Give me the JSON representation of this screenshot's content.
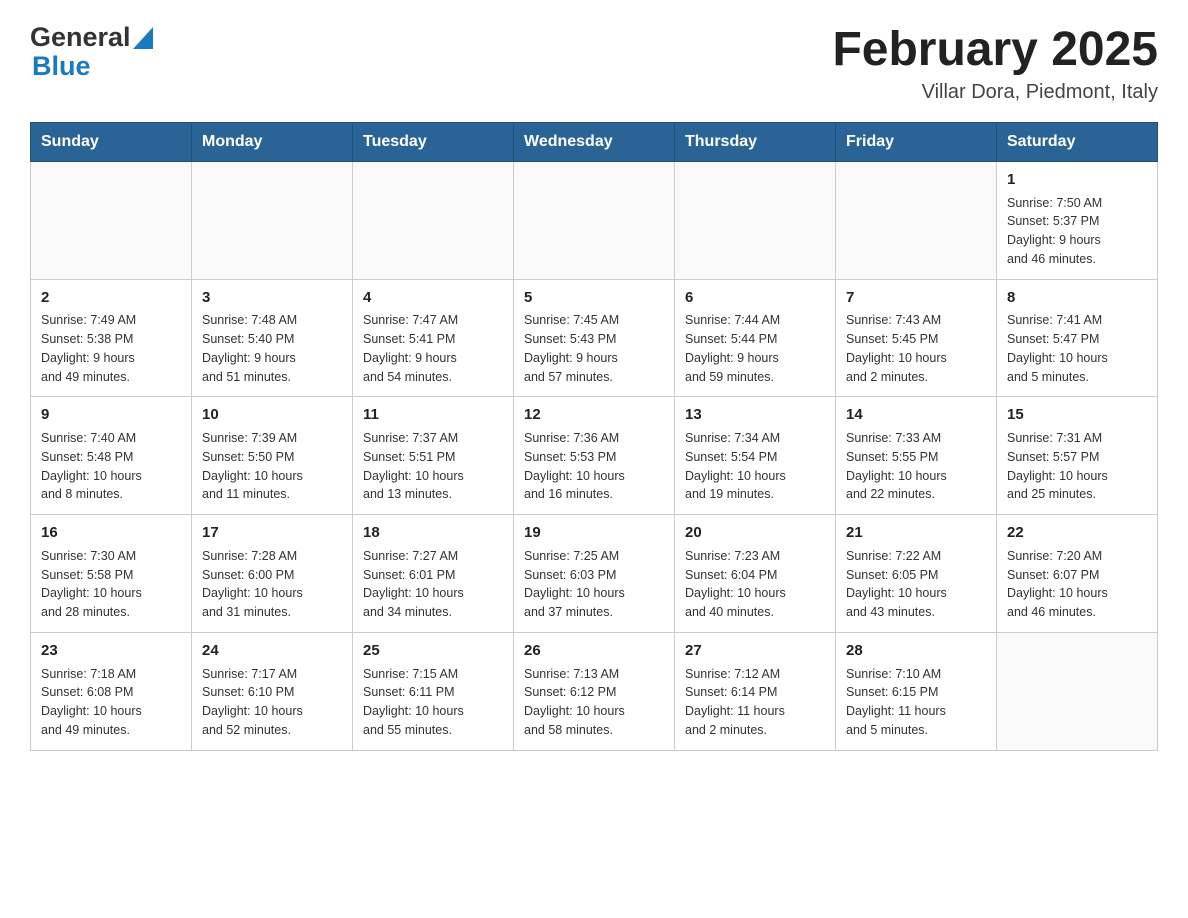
{
  "header": {
    "logo_general": "General",
    "logo_blue": "Blue",
    "title": "February 2025",
    "subtitle": "Villar Dora, Piedmont, Italy"
  },
  "weekdays": [
    "Sunday",
    "Monday",
    "Tuesday",
    "Wednesday",
    "Thursday",
    "Friday",
    "Saturday"
  ],
  "weeks": [
    [
      {
        "day": "",
        "info": ""
      },
      {
        "day": "",
        "info": ""
      },
      {
        "day": "",
        "info": ""
      },
      {
        "day": "",
        "info": ""
      },
      {
        "day": "",
        "info": ""
      },
      {
        "day": "",
        "info": ""
      },
      {
        "day": "1",
        "info": "Sunrise: 7:50 AM\nSunset: 5:37 PM\nDaylight: 9 hours\nand 46 minutes."
      }
    ],
    [
      {
        "day": "2",
        "info": "Sunrise: 7:49 AM\nSunset: 5:38 PM\nDaylight: 9 hours\nand 49 minutes."
      },
      {
        "day": "3",
        "info": "Sunrise: 7:48 AM\nSunset: 5:40 PM\nDaylight: 9 hours\nand 51 minutes."
      },
      {
        "day": "4",
        "info": "Sunrise: 7:47 AM\nSunset: 5:41 PM\nDaylight: 9 hours\nand 54 minutes."
      },
      {
        "day": "5",
        "info": "Sunrise: 7:45 AM\nSunset: 5:43 PM\nDaylight: 9 hours\nand 57 minutes."
      },
      {
        "day": "6",
        "info": "Sunrise: 7:44 AM\nSunset: 5:44 PM\nDaylight: 9 hours\nand 59 minutes."
      },
      {
        "day": "7",
        "info": "Sunrise: 7:43 AM\nSunset: 5:45 PM\nDaylight: 10 hours\nand 2 minutes."
      },
      {
        "day": "8",
        "info": "Sunrise: 7:41 AM\nSunset: 5:47 PM\nDaylight: 10 hours\nand 5 minutes."
      }
    ],
    [
      {
        "day": "9",
        "info": "Sunrise: 7:40 AM\nSunset: 5:48 PM\nDaylight: 10 hours\nand 8 minutes."
      },
      {
        "day": "10",
        "info": "Sunrise: 7:39 AM\nSunset: 5:50 PM\nDaylight: 10 hours\nand 11 minutes."
      },
      {
        "day": "11",
        "info": "Sunrise: 7:37 AM\nSunset: 5:51 PM\nDaylight: 10 hours\nand 13 minutes."
      },
      {
        "day": "12",
        "info": "Sunrise: 7:36 AM\nSunset: 5:53 PM\nDaylight: 10 hours\nand 16 minutes."
      },
      {
        "day": "13",
        "info": "Sunrise: 7:34 AM\nSunset: 5:54 PM\nDaylight: 10 hours\nand 19 minutes."
      },
      {
        "day": "14",
        "info": "Sunrise: 7:33 AM\nSunset: 5:55 PM\nDaylight: 10 hours\nand 22 minutes."
      },
      {
        "day": "15",
        "info": "Sunrise: 7:31 AM\nSunset: 5:57 PM\nDaylight: 10 hours\nand 25 minutes."
      }
    ],
    [
      {
        "day": "16",
        "info": "Sunrise: 7:30 AM\nSunset: 5:58 PM\nDaylight: 10 hours\nand 28 minutes."
      },
      {
        "day": "17",
        "info": "Sunrise: 7:28 AM\nSunset: 6:00 PM\nDaylight: 10 hours\nand 31 minutes."
      },
      {
        "day": "18",
        "info": "Sunrise: 7:27 AM\nSunset: 6:01 PM\nDaylight: 10 hours\nand 34 minutes."
      },
      {
        "day": "19",
        "info": "Sunrise: 7:25 AM\nSunset: 6:03 PM\nDaylight: 10 hours\nand 37 minutes."
      },
      {
        "day": "20",
        "info": "Sunrise: 7:23 AM\nSunset: 6:04 PM\nDaylight: 10 hours\nand 40 minutes."
      },
      {
        "day": "21",
        "info": "Sunrise: 7:22 AM\nSunset: 6:05 PM\nDaylight: 10 hours\nand 43 minutes."
      },
      {
        "day": "22",
        "info": "Sunrise: 7:20 AM\nSunset: 6:07 PM\nDaylight: 10 hours\nand 46 minutes."
      }
    ],
    [
      {
        "day": "23",
        "info": "Sunrise: 7:18 AM\nSunset: 6:08 PM\nDaylight: 10 hours\nand 49 minutes."
      },
      {
        "day": "24",
        "info": "Sunrise: 7:17 AM\nSunset: 6:10 PM\nDaylight: 10 hours\nand 52 minutes."
      },
      {
        "day": "25",
        "info": "Sunrise: 7:15 AM\nSunset: 6:11 PM\nDaylight: 10 hours\nand 55 minutes."
      },
      {
        "day": "26",
        "info": "Sunrise: 7:13 AM\nSunset: 6:12 PM\nDaylight: 10 hours\nand 58 minutes."
      },
      {
        "day": "27",
        "info": "Sunrise: 7:12 AM\nSunset: 6:14 PM\nDaylight: 11 hours\nand 2 minutes."
      },
      {
        "day": "28",
        "info": "Sunrise: 7:10 AM\nSunset: 6:15 PM\nDaylight: 11 hours\nand 5 minutes."
      },
      {
        "day": "",
        "info": ""
      }
    ]
  ]
}
